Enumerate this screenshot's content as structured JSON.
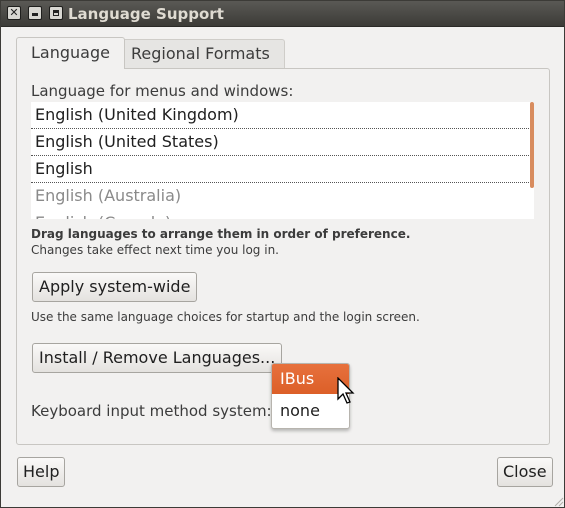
{
  "window": {
    "title": "Language Support"
  },
  "tabs": [
    {
      "label": "Language",
      "active": true
    },
    {
      "label": "Regional Formats",
      "active": false
    }
  ],
  "language": {
    "list_label": "Language for menus and windows:",
    "languages": [
      "English (United Kingdom)",
      "English (United States)",
      "English",
      "English (Australia)",
      "English (Canada)"
    ],
    "drag_hint": "Drag languages to arrange them in order of preference.",
    "effect_hint": "Changes take effect next time you log in.",
    "apply_button": "Apply system-wide",
    "apply_hint": "Use the same language choices for startup and the login screen.",
    "install_button": "Install / Remove Languages...",
    "keyboard_label": "Keyboard input method system:",
    "keyboard_options": [
      "IBus",
      "none"
    ],
    "keyboard_selected": "IBus"
  },
  "footer": {
    "help_button": "Help",
    "close_button": "Close"
  },
  "colors": {
    "accent": "#dd6433",
    "titlebar": "#3c3b37",
    "background": "#f2f1f0"
  }
}
